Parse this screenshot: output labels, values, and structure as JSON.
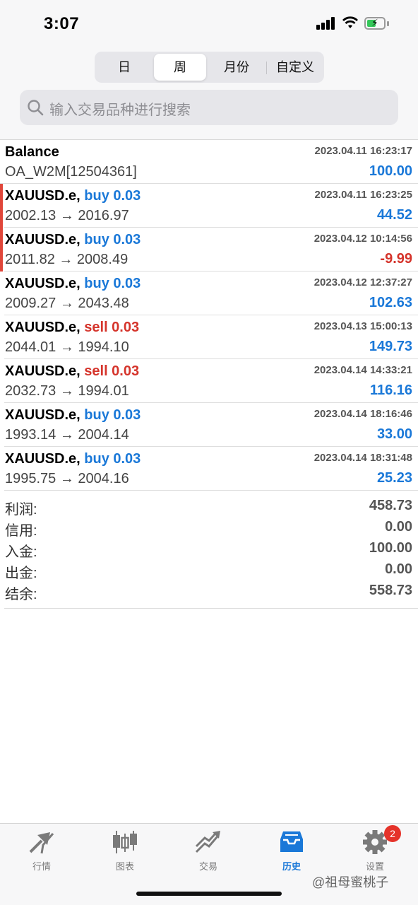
{
  "status_bar": {
    "time": "3:07"
  },
  "segments": [
    {
      "label": "日",
      "active": false
    },
    {
      "label": "周",
      "active": true
    },
    {
      "label": "月份",
      "active": false
    },
    {
      "label": "自定义",
      "active": false
    }
  ],
  "search": {
    "placeholder": "输入交易品种进行搜索"
  },
  "balance_row": {
    "title": "Balance",
    "date": "2023.04.11 16:23:17",
    "account": "OA_W2M[12504361]",
    "value": "100.00"
  },
  "trades": [
    {
      "symbol": "XAUUSD.e,",
      "side": "buy 0.03",
      "date": "2023.04.11 16:23:25",
      "prices": "2002.13 → 2016.97",
      "profit": "44.52"
    },
    {
      "symbol": "XAUUSD.e,",
      "side": "buy 0.03",
      "date": "2023.04.12 10:14:56",
      "prices": "2011.82 → 2008.49",
      "profit": "-9.99"
    },
    {
      "symbol": "XAUUSD.e,",
      "side": "buy 0.03",
      "date": "2023.04.12 12:37:27",
      "prices": "2009.27 → 2043.48",
      "profit": "102.63"
    },
    {
      "symbol": "XAUUSD.e,",
      "side": "sell 0.03",
      "date": "2023.04.13 15:00:13",
      "prices": "2044.01 → 1994.10",
      "profit": "149.73"
    },
    {
      "symbol": "XAUUSD.e,",
      "side": "sell 0.03",
      "date": "2023.04.14 14:33:21",
      "prices": "2032.73 → 1994.01",
      "profit": "116.16"
    },
    {
      "symbol": "XAUUSD.e,",
      "side": "buy 0.03",
      "date": "2023.04.14 18:16:46",
      "prices": "1993.14 → 2004.14",
      "profit": "33.00"
    },
    {
      "symbol": "XAUUSD.e,",
      "side": "buy 0.03",
      "date": "2023.04.14 18:31:48",
      "prices": "1995.75 → 2004.16",
      "profit": "25.23"
    }
  ],
  "summary": [
    {
      "label": "利润:",
      "value": "458.73"
    },
    {
      "label": "信用:",
      "value": "0.00"
    },
    {
      "label": "入金:",
      "value": "100.00"
    },
    {
      "label": "出金:",
      "value": "0.00"
    },
    {
      "label": "结余:",
      "value": "558.73"
    }
  ],
  "tabbar": {
    "items": [
      {
        "label": "行情",
        "icon": "quotes-arrows-icon"
      },
      {
        "label": "图表",
        "icon": "chart-candles-icon"
      },
      {
        "label": "交易",
        "icon": "trade-trend-icon"
      },
      {
        "label": "历史",
        "icon": "history-tray-icon"
      },
      {
        "label": "设置",
        "icon": "gear-icon"
      }
    ],
    "active_index": 3,
    "settings_badge": "2"
  },
  "watermark": "@祖母蜜桃子",
  "colors": {
    "accent_blue": "#1a78d8",
    "negative_red": "#d5342b",
    "badge_red": "#e5332a"
  }
}
